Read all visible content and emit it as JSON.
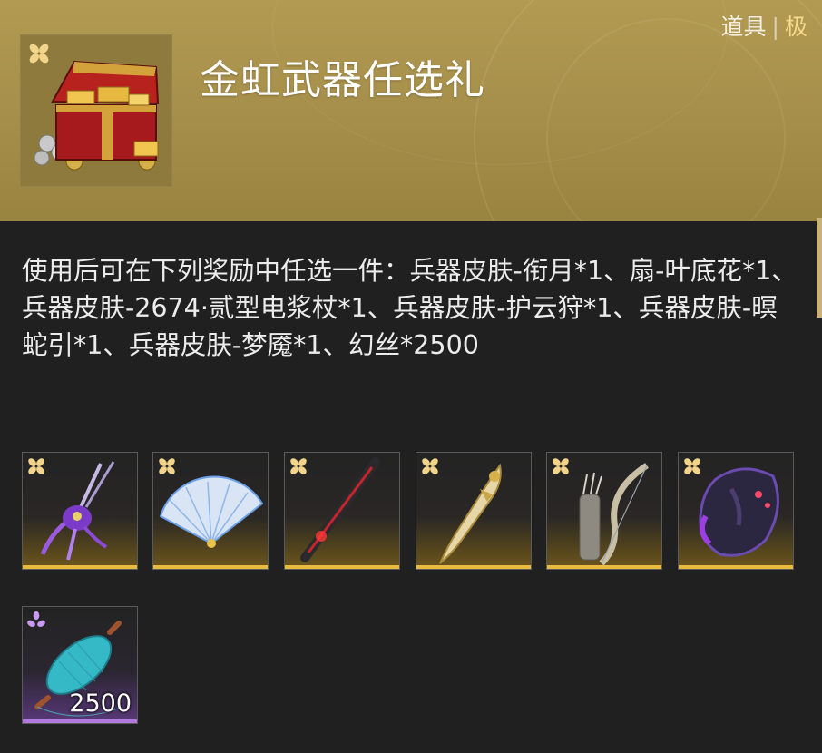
{
  "header": {
    "title": "金虹武器任选礼",
    "tag_type": "道具",
    "tag_separator": "|",
    "tag_grade": "极",
    "icon": "treasure-chest-icon"
  },
  "description": "使用后可在下列奖励中任选一件：兵器皮肤-衔月*1、扇-叶底花*1、兵器皮肤-2674·贰型电浆杖*1、兵器皮肤-护云狩*1、兵器皮肤-暝蛇引*1、兵器皮肤-梦魇*1、幻丝*2500",
  "rewards": [
    {
      "icon": "purple-blade-icon",
      "rarity": "gold",
      "count": ""
    },
    {
      "icon": "crystal-fan-icon",
      "rarity": "gold",
      "count": ""
    },
    {
      "icon": "red-staff-icon",
      "rarity": "gold",
      "count": ""
    },
    {
      "icon": "golden-blade-icon",
      "rarity": "gold",
      "count": ""
    },
    {
      "icon": "bone-bow-icon",
      "rarity": "gold",
      "count": ""
    },
    {
      "icon": "nightmare-gauntlet-icon",
      "rarity": "gold",
      "count": ""
    },
    {
      "icon": "silk-spool-icon",
      "rarity": "purple",
      "count": "2500"
    }
  ],
  "colors": {
    "gold_accent": "#e8bb3e",
    "purple_accent": "#b27adf",
    "header_bg": "#a58e4a",
    "panel_bg": "#202021"
  }
}
